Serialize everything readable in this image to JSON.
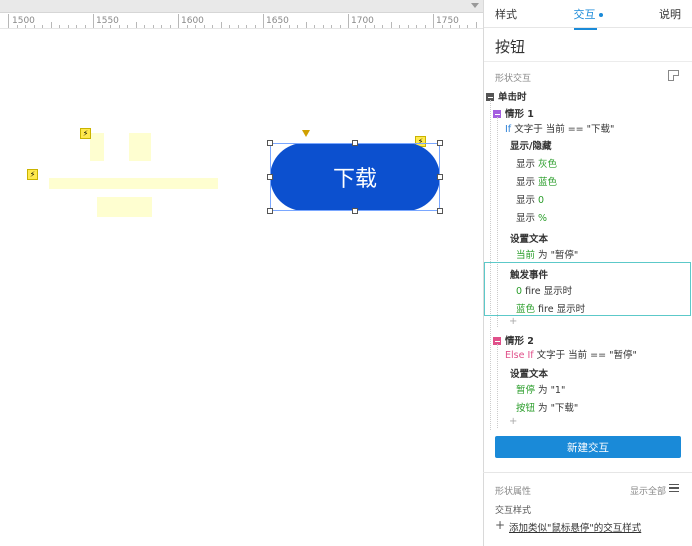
{
  "ruler": {
    "labels": [
      "1500",
      "1550",
      "1600",
      "1650",
      "1700",
      "1750"
    ]
  },
  "canvas": {
    "button_text": "下载"
  },
  "panel": {
    "tabs": [
      "样式",
      "交互",
      "说明"
    ],
    "widget_name": "按钮",
    "section_label": "形状交互",
    "event": "单击时",
    "case1": {
      "name": "情形 1",
      "condition_keyword": "If",
      "condition_rest": "文字于 当前 == \"下载\"",
      "action_show_hide": "显示/隐藏",
      "show_items": [
        {
          "verb": "显示",
          "target": "灰色"
        },
        {
          "verb": "显示",
          "target": "蓝色"
        },
        {
          "verb": "显示",
          "target": "0"
        },
        {
          "verb": "显示",
          "target": "%"
        }
      ],
      "action_set_text": "设置文本",
      "set_text_target": "当前",
      "set_text_rest": "为 \"暂停\"",
      "action_fire": "触发事件",
      "fire_items": [
        {
          "target": "0",
          "rest": "fire 显示时"
        },
        {
          "target": "蓝色",
          "rest": "fire 显示时"
        }
      ]
    },
    "case2": {
      "name": "情形 2",
      "condition_keyword": "Else If",
      "condition_rest": "文字于 当前 == \"暂停\"",
      "action_set_text": "设置文本",
      "set_items": [
        {
          "target": "暂停",
          "rest": "为 \"1\""
        },
        {
          "target": "按钮",
          "rest": "为 \"下载\""
        }
      ]
    },
    "plus": "+",
    "new_interaction": "新建交互",
    "shape_props_label": "形状属性",
    "show_all": "显示全部",
    "interaction_style_label": "交互样式",
    "add_style_plus": "+",
    "add_style_link": "添加类似\"鼠标悬停\"的交互样式"
  },
  "colors": {
    "button_blue": "#0c50cf",
    "accent": "#1a8ad8",
    "highlight": "#5cc9c9",
    "green_text": "#2a9d2a"
  }
}
